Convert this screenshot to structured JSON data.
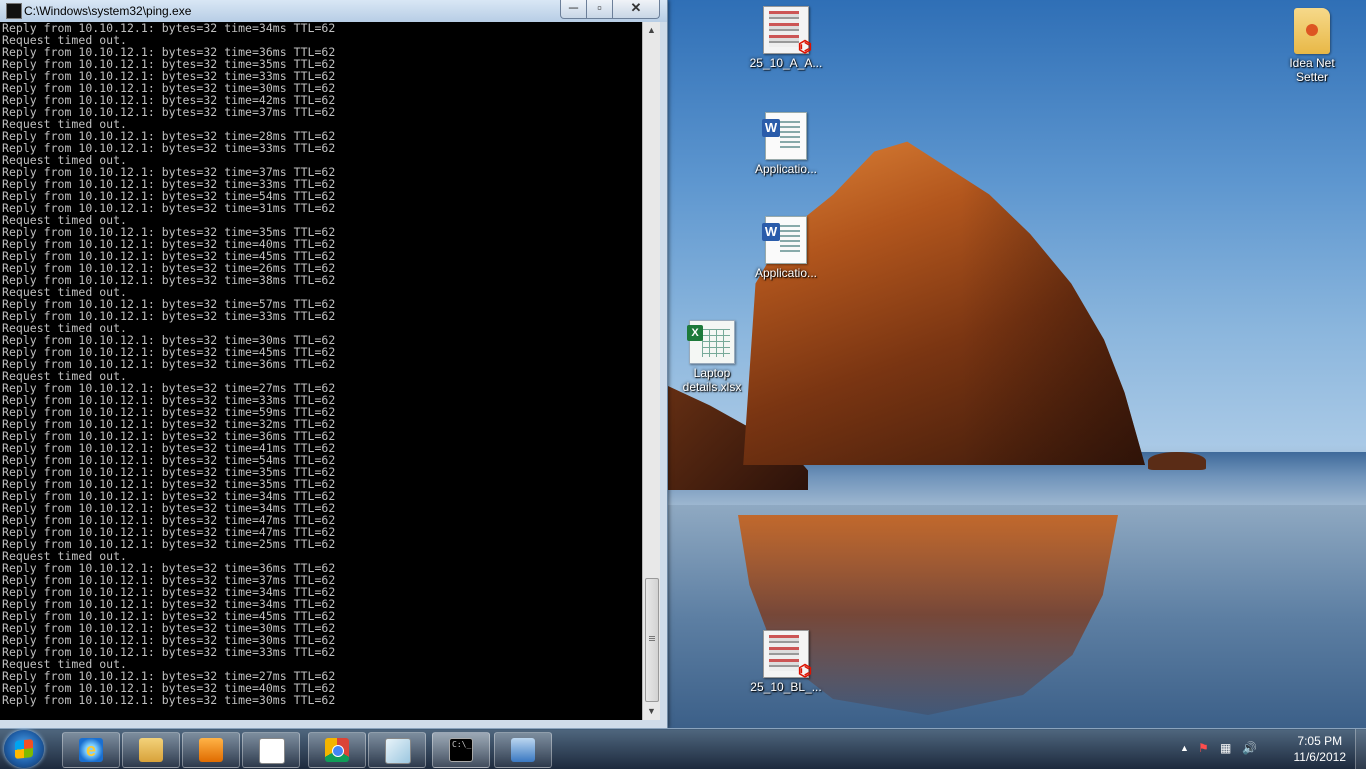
{
  "window": {
    "title": "C:\\Windows\\system32\\ping.exe",
    "buttons": {
      "minimize": "─",
      "maximize": "▫",
      "close": "✕"
    }
  },
  "console_lines": [
    "Reply from 10.10.12.1: bytes=32 time=34ms TTL=62",
    "Request timed out.",
    "Reply from 10.10.12.1: bytes=32 time=36ms TTL=62",
    "Reply from 10.10.12.1: bytes=32 time=35ms TTL=62",
    "Reply from 10.10.12.1: bytes=32 time=33ms TTL=62",
    "Reply from 10.10.12.1: bytes=32 time=30ms TTL=62",
    "Reply from 10.10.12.1: bytes=32 time=42ms TTL=62",
    "Reply from 10.10.12.1: bytes=32 time=37ms TTL=62",
    "Request timed out.",
    "Reply from 10.10.12.1: bytes=32 time=28ms TTL=62",
    "Reply from 10.10.12.1: bytes=32 time=33ms TTL=62",
    "Request timed out.",
    "Reply from 10.10.12.1: bytes=32 time=37ms TTL=62",
    "Reply from 10.10.12.1: bytes=32 time=33ms TTL=62",
    "Reply from 10.10.12.1: bytes=32 time=54ms TTL=62",
    "Reply from 10.10.12.1: bytes=32 time=31ms TTL=62",
    "Request timed out.",
    "Reply from 10.10.12.1: bytes=32 time=35ms TTL=62",
    "Reply from 10.10.12.1: bytes=32 time=40ms TTL=62",
    "Reply from 10.10.12.1: bytes=32 time=45ms TTL=62",
    "Reply from 10.10.12.1: bytes=32 time=26ms TTL=62",
    "Reply from 10.10.12.1: bytes=32 time=38ms TTL=62",
    "Request timed out.",
    "Reply from 10.10.12.1: bytes=32 time=57ms TTL=62",
    "Reply from 10.10.12.1: bytes=32 time=33ms TTL=62",
    "Request timed out.",
    "Reply from 10.10.12.1: bytes=32 time=30ms TTL=62",
    "Reply from 10.10.12.1: bytes=32 time=45ms TTL=62",
    "Reply from 10.10.12.1: bytes=32 time=36ms TTL=62",
    "Request timed out.",
    "Reply from 10.10.12.1: bytes=32 time=27ms TTL=62",
    "Reply from 10.10.12.1: bytes=32 time=33ms TTL=62",
    "Reply from 10.10.12.1: bytes=32 time=59ms TTL=62",
    "Reply from 10.10.12.1: bytes=32 time=32ms TTL=62",
    "Reply from 10.10.12.1: bytes=32 time=36ms TTL=62",
    "Reply from 10.10.12.1: bytes=32 time=41ms TTL=62",
    "Reply from 10.10.12.1: bytes=32 time=54ms TTL=62",
    "Reply from 10.10.12.1: bytes=32 time=35ms TTL=62",
    "Reply from 10.10.12.1: bytes=32 time=35ms TTL=62",
    "Reply from 10.10.12.1: bytes=32 time=34ms TTL=62",
    "Reply from 10.10.12.1: bytes=32 time=34ms TTL=62",
    "Reply from 10.10.12.1: bytes=32 time=47ms TTL=62",
    "Reply from 10.10.12.1: bytes=32 time=47ms TTL=62",
    "Reply from 10.10.12.1: bytes=32 time=25ms TTL=62",
    "Request timed out.",
    "Reply from 10.10.12.1: bytes=32 time=36ms TTL=62",
    "Reply from 10.10.12.1: bytes=32 time=37ms TTL=62",
    "Reply from 10.10.12.1: bytes=32 time=34ms TTL=62",
    "Reply from 10.10.12.1: bytes=32 time=34ms TTL=62",
    "Reply from 10.10.12.1: bytes=32 time=45ms TTL=62",
    "Reply from 10.10.12.1: bytes=32 time=30ms TTL=62",
    "Reply from 10.10.12.1: bytes=32 time=30ms TTL=62",
    "Reply from 10.10.12.1: bytes=32 time=33ms TTL=62",
    "Request timed out.",
    "Reply from 10.10.12.1: bytes=32 time=27ms TTL=62",
    "Reply from 10.10.12.1: bytes=32 time=40ms TTL=62",
    "Reply from 10.10.12.1: bytes=32 time=30ms TTL=62"
  ],
  "desktop_icons": [
    {
      "label": "25_10_A_A...",
      "icon": "pdf-icon"
    },
    {
      "label": "Applicatio...",
      "icon": "word-doc-icon"
    },
    {
      "label": "Applicatio...",
      "icon": "word-doc-icon"
    },
    {
      "label_line1": "Laptop",
      "label_line2": "details.xlsx",
      "icon": "excel-icon"
    },
    {
      "label": "25_10_BL_...",
      "icon": "pdf-icon"
    },
    {
      "label_line1": "Idea Net",
      "label_line2": "Setter",
      "icon": "folder-icon"
    }
  ],
  "taskbar": {
    "pinned": [
      "start-button",
      "internet-explorer",
      "windows-explorer",
      "media-player",
      "notepad",
      "chrome",
      "app-notes",
      "command-prompt",
      "network-connections"
    ],
    "cmd_glyph": "C:\\_",
    "ie_glyph": "e"
  },
  "tray": {
    "show_hidden": "▲",
    "action_center": "⚑",
    "network": "▦",
    "volume": "🔊",
    "time": "7:05 PM",
    "date": "11/6/2012"
  },
  "colors": {
    "console_bg": "#000000",
    "console_fg": "#c0c0c0",
    "taskbar": "#1a2a40"
  }
}
